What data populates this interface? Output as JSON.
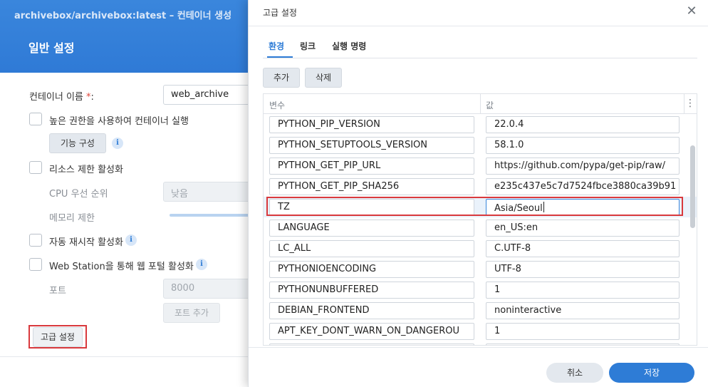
{
  "background": {
    "window_title": "archivebox/archivebox:latest – 컨테이너 생성",
    "section_title": "일반 설정",
    "container_name_label": "컨테이너 이름 ",
    "required_mark": "*",
    "colon": ":",
    "container_name_value": "web_archive",
    "high_privilege_label": "높은 권한을 사용하여 컨테이너 실행",
    "capabilities_button": "기능 구성",
    "resource_limit_label": "리소스 제한 활성화",
    "cpu_priority_label": "CPU 우선 순위",
    "cpu_priority_value": "낮음",
    "memory_limit_label": "메모리 제한",
    "auto_restart_label": "자동 재시작 활성화",
    "web_station_label": "Web Station을 통해 웹 포털 활성화",
    "port_label": "포트",
    "port_value": "8000",
    "add_port_button": "포트 추가",
    "advanced_button": "고급 설정",
    "info_glyph": "i"
  },
  "modal": {
    "title": "고급 설정",
    "close_glyph": "✕",
    "tabs": [
      {
        "label": "환경",
        "active": true
      },
      {
        "label": "링크",
        "active": false
      },
      {
        "label": "실행 명령",
        "active": false
      }
    ],
    "toolbar": {
      "add_label": "추가",
      "delete_label": "삭제"
    },
    "grid": {
      "columns": [
        "변수",
        "값"
      ],
      "more_glyph": "⋮",
      "rows": [
        {
          "key": "PYTHON_PIP_VERSION",
          "value": "22.0.4"
        },
        {
          "key": "PYTHON_SETUPTOOLS_VERSION",
          "value": "58.1.0"
        },
        {
          "key": "PYTHON_GET_PIP_URL",
          "value": "https://github.com/pypa/get-pip/raw/"
        },
        {
          "key": "PYTHON_GET_PIP_SHA256",
          "value": "e235c437e5c7d7524fbce3880ca39b91"
        },
        {
          "key": "TZ",
          "value": "Asia/Seoul"
        },
        {
          "key": "LANGUAGE",
          "value": "en_US:en"
        },
        {
          "key": "LC_ALL",
          "value": "C.UTF-8"
        },
        {
          "key": "PYTHONIOENCODING",
          "value": "UTF-8"
        },
        {
          "key": "PYTHONUNBUFFERED",
          "value": "1"
        },
        {
          "key": "DEBIAN_FRONTEND",
          "value": "noninteractive"
        },
        {
          "key": "APT_KEY_DONT_WARN_ON_DANGEROU",
          "value": "1"
        }
      ]
    },
    "footer": {
      "cancel_label": "취소",
      "save_label": "저장"
    }
  },
  "colors": {
    "accent": "#2e7cd6",
    "header": "#3a86dc",
    "highlight": "#d9393d"
  }
}
